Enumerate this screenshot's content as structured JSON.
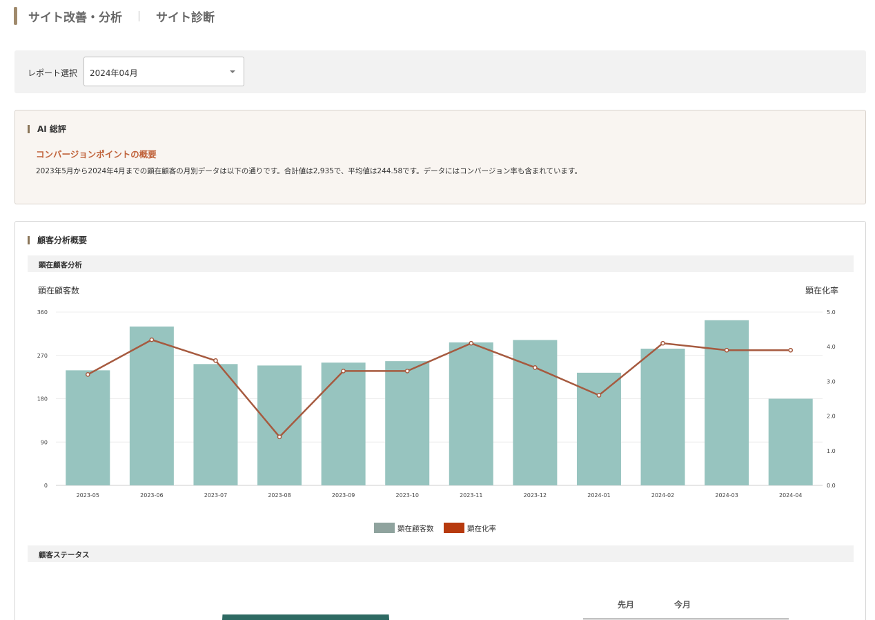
{
  "header": {
    "title_main": "サイト改善・分析",
    "title_sub": "サイト診断"
  },
  "report": {
    "label": "レポート選択",
    "selected": "2024年04月"
  },
  "ai_summary": {
    "heading": "AI 総評",
    "subheading": "コンバージョンポイントの概要",
    "body": "2023年5月から2024年4月までの顕在顧客の月別データは以下の通りです。合計値は2,935で、平均値は244.58です。データにはコンバージョン率も含まれています。"
  },
  "customer_analysis": {
    "heading": "顧客分析概要",
    "subsection1": "顕在顧客分析",
    "subsection2": "顧客ステータス",
    "status_columns": [
      "先月",
      "今月"
    ]
  },
  "colors": {
    "bar": "#97c4bf",
    "line": "#a65a3f",
    "legend_bar": "#8fa39e",
    "legend_line": "#b73a0e",
    "accent": "#a08a6c",
    "ai_subheading": "#c0623a"
  },
  "chart_data": {
    "type": "bar",
    "categories": [
      "2023-05",
      "2023-06",
      "2023-07",
      "2023-08",
      "2023-09",
      "2023-10",
      "2023-11",
      "2023-12",
      "2024-01",
      "2024-02",
      "2024-03",
      "2024-04"
    ],
    "series": [
      {
        "name": "顕在顧客数",
        "kind": "bar",
        "axis": "left",
        "values": [
          239,
          330,
          252,
          249,
          255,
          258,
          297,
          302,
          234,
          284,
          343,
          180
        ]
      },
      {
        "name": "顕在化率",
        "kind": "line",
        "axis": "right",
        "values": [
          3.2,
          4.2,
          3.6,
          1.4,
          3.3,
          3.3,
          4.1,
          3.4,
          2.6,
          4.1,
          3.9,
          3.9
        ]
      }
    ],
    "ylabel_left": "顕在顧客数",
    "ylabel_right": "顕在化率",
    "ylim_left": [
      0,
      360
    ],
    "ylim_right": [
      0,
      5
    ],
    "yticks_left": [
      "0",
      "90",
      "180",
      "270",
      "360"
    ],
    "yticks_right": [
      "0.0",
      "1.0",
      "2.0",
      "3.0",
      "4.0",
      "5.0"
    ],
    "grid": true,
    "legend": "bottom-center"
  }
}
